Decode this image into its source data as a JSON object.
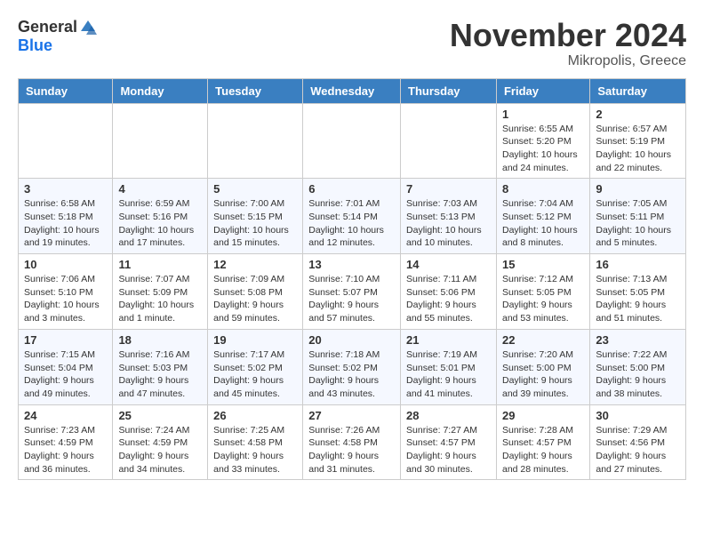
{
  "header": {
    "logo_general": "General",
    "logo_blue": "Blue",
    "month_title": "November 2024",
    "location": "Mikropolis, Greece"
  },
  "weekdays": [
    "Sunday",
    "Monday",
    "Tuesday",
    "Wednesday",
    "Thursday",
    "Friday",
    "Saturday"
  ],
  "weeks": [
    [
      {
        "day": "",
        "info": ""
      },
      {
        "day": "",
        "info": ""
      },
      {
        "day": "",
        "info": ""
      },
      {
        "day": "",
        "info": ""
      },
      {
        "day": "",
        "info": ""
      },
      {
        "day": "1",
        "info": "Sunrise: 6:55 AM\nSunset: 5:20 PM\nDaylight: 10 hours\nand 24 minutes."
      },
      {
        "day": "2",
        "info": "Sunrise: 6:57 AM\nSunset: 5:19 PM\nDaylight: 10 hours\nand 22 minutes."
      }
    ],
    [
      {
        "day": "3",
        "info": "Sunrise: 6:58 AM\nSunset: 5:18 PM\nDaylight: 10 hours\nand 19 minutes."
      },
      {
        "day": "4",
        "info": "Sunrise: 6:59 AM\nSunset: 5:16 PM\nDaylight: 10 hours\nand 17 minutes."
      },
      {
        "day": "5",
        "info": "Sunrise: 7:00 AM\nSunset: 5:15 PM\nDaylight: 10 hours\nand 15 minutes."
      },
      {
        "day": "6",
        "info": "Sunrise: 7:01 AM\nSunset: 5:14 PM\nDaylight: 10 hours\nand 12 minutes."
      },
      {
        "day": "7",
        "info": "Sunrise: 7:03 AM\nSunset: 5:13 PM\nDaylight: 10 hours\nand 10 minutes."
      },
      {
        "day": "8",
        "info": "Sunrise: 7:04 AM\nSunset: 5:12 PM\nDaylight: 10 hours\nand 8 minutes."
      },
      {
        "day": "9",
        "info": "Sunrise: 7:05 AM\nSunset: 5:11 PM\nDaylight: 10 hours\nand 5 minutes."
      }
    ],
    [
      {
        "day": "10",
        "info": "Sunrise: 7:06 AM\nSunset: 5:10 PM\nDaylight: 10 hours\nand 3 minutes."
      },
      {
        "day": "11",
        "info": "Sunrise: 7:07 AM\nSunset: 5:09 PM\nDaylight: 10 hours\nand 1 minute."
      },
      {
        "day": "12",
        "info": "Sunrise: 7:09 AM\nSunset: 5:08 PM\nDaylight: 9 hours\nand 59 minutes."
      },
      {
        "day": "13",
        "info": "Sunrise: 7:10 AM\nSunset: 5:07 PM\nDaylight: 9 hours\nand 57 minutes."
      },
      {
        "day": "14",
        "info": "Sunrise: 7:11 AM\nSunset: 5:06 PM\nDaylight: 9 hours\nand 55 minutes."
      },
      {
        "day": "15",
        "info": "Sunrise: 7:12 AM\nSunset: 5:05 PM\nDaylight: 9 hours\nand 53 minutes."
      },
      {
        "day": "16",
        "info": "Sunrise: 7:13 AM\nSunset: 5:05 PM\nDaylight: 9 hours\nand 51 minutes."
      }
    ],
    [
      {
        "day": "17",
        "info": "Sunrise: 7:15 AM\nSunset: 5:04 PM\nDaylight: 9 hours\nand 49 minutes."
      },
      {
        "day": "18",
        "info": "Sunrise: 7:16 AM\nSunset: 5:03 PM\nDaylight: 9 hours\nand 47 minutes."
      },
      {
        "day": "19",
        "info": "Sunrise: 7:17 AM\nSunset: 5:02 PM\nDaylight: 9 hours\nand 45 minutes."
      },
      {
        "day": "20",
        "info": "Sunrise: 7:18 AM\nSunset: 5:02 PM\nDaylight: 9 hours\nand 43 minutes."
      },
      {
        "day": "21",
        "info": "Sunrise: 7:19 AM\nSunset: 5:01 PM\nDaylight: 9 hours\nand 41 minutes."
      },
      {
        "day": "22",
        "info": "Sunrise: 7:20 AM\nSunset: 5:00 PM\nDaylight: 9 hours\nand 39 minutes."
      },
      {
        "day": "23",
        "info": "Sunrise: 7:22 AM\nSunset: 5:00 PM\nDaylight: 9 hours\nand 38 minutes."
      }
    ],
    [
      {
        "day": "24",
        "info": "Sunrise: 7:23 AM\nSunset: 4:59 PM\nDaylight: 9 hours\nand 36 minutes."
      },
      {
        "day": "25",
        "info": "Sunrise: 7:24 AM\nSunset: 4:59 PM\nDaylight: 9 hours\nand 34 minutes."
      },
      {
        "day": "26",
        "info": "Sunrise: 7:25 AM\nSunset: 4:58 PM\nDaylight: 9 hours\nand 33 minutes."
      },
      {
        "day": "27",
        "info": "Sunrise: 7:26 AM\nSunset: 4:58 PM\nDaylight: 9 hours\nand 31 minutes."
      },
      {
        "day": "28",
        "info": "Sunrise: 7:27 AM\nSunset: 4:57 PM\nDaylight: 9 hours\nand 30 minutes."
      },
      {
        "day": "29",
        "info": "Sunrise: 7:28 AM\nSunset: 4:57 PM\nDaylight: 9 hours\nand 28 minutes."
      },
      {
        "day": "30",
        "info": "Sunrise: 7:29 AM\nSunset: 4:56 PM\nDaylight: 9 hours\nand 27 minutes."
      }
    ]
  ]
}
